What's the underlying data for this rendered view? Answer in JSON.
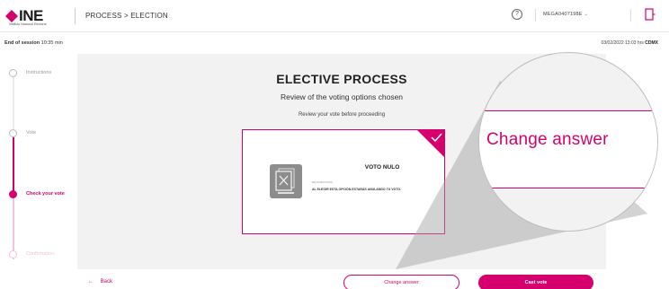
{
  "header": {
    "logo_text": "INE",
    "logo_subtext": "Instituto Nacional Electoral",
    "breadcrumb": "PROCESS > ELECTION",
    "help_label": "?",
    "user": "MEGA0407198E",
    "user_chevron": "⌄"
  },
  "session": {
    "label": "End of session",
    "remaining": "10:35 min",
    "datetime": "03/02/2022 13:03 hrs",
    "zone": "CDMX"
  },
  "steps": [
    {
      "label": "Instructions",
      "state": "done"
    },
    {
      "label": "Vote",
      "state": "done"
    },
    {
      "label": "Check your vote",
      "state": "active"
    },
    {
      "label": "Confirmation",
      "state": "pending"
    }
  ],
  "main": {
    "title": "ELECTIVE PROCESS",
    "subtitle": "Review of the voting options chosen",
    "hint": "Review your vote before proceeding"
  },
  "card": {
    "option_title": "VOTO NULO",
    "desc_label": "DESCRIPCIÓN",
    "description": "AL ELEGIR ESTA OPCIÓN ESTARÁS ANULANDO TU VOTO."
  },
  "footer": {
    "back_arrow": "←",
    "back_label": "Back",
    "change_label": "Change answer",
    "cast_label": "Cast vote"
  },
  "magnifier": {
    "text": "Change answer"
  },
  "colors": {
    "accent": "#d5006d",
    "content_bg": "#f2f2f2"
  },
  "icons": [
    "ine-logo-icon",
    "help-icon",
    "chevron-down-icon",
    "exit-icon",
    "checkmark-icon",
    "null-vote-icon",
    "back-arrow-icon"
  ]
}
